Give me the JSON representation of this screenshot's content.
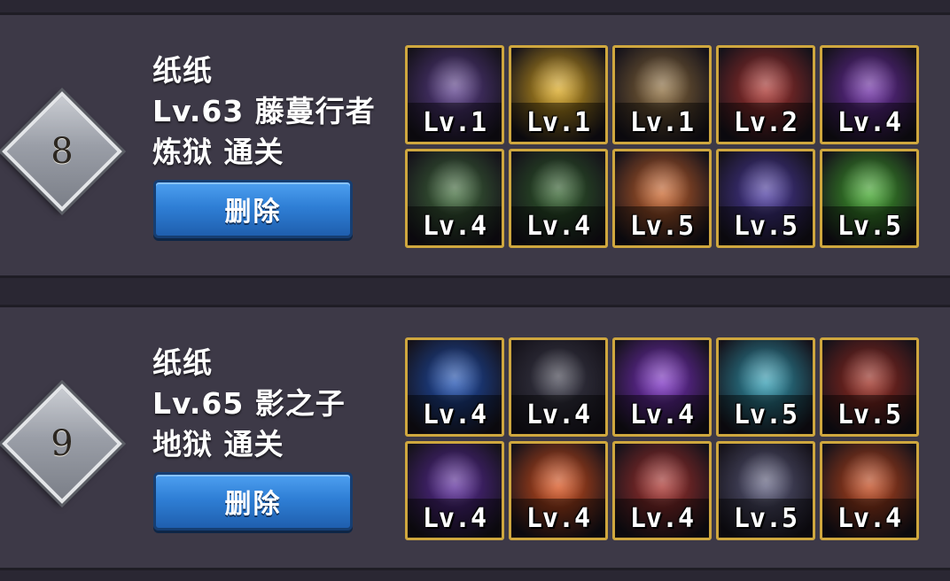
{
  "entries": [
    {
      "rank": "8",
      "name": "纸纸",
      "level_class": "Lv.63 藤蔓行者",
      "stage": "炼狱 通关",
      "delete_label": "删除",
      "skills": [
        {
          "icon": "dark-cloak-icon",
          "level": "Lv.1",
          "color": "#5a3d8a"
        },
        {
          "icon": "golden-burst-icon",
          "level": "Lv.1",
          "color": "#d8a51c"
        },
        {
          "icon": "star-slash-icon",
          "level": "Lv.1",
          "color": "#8a6a3a"
        },
        {
          "icon": "red-claw-icon",
          "level": "Lv.2",
          "color": "#a8312c"
        },
        {
          "icon": "purple-shadow-icon",
          "level": "Lv.4",
          "color": "#6b2ba3"
        },
        {
          "icon": "green-vines-icon",
          "level": "Lv.4",
          "color": "#3f6a3a"
        },
        {
          "icon": "green-blade-icon",
          "level": "Lv.4",
          "color": "#2f5e2a"
        },
        {
          "icon": "shield-emblem-icon",
          "level": "Lv.5",
          "color": "#c8632a"
        },
        {
          "icon": "purple-serpent-icon",
          "level": "Lv.5",
          "color": "#4b3aa0"
        },
        {
          "icon": "green-totem-icon",
          "level": "Lv.5",
          "color": "#3fa52a"
        }
      ]
    },
    {
      "rank": "9",
      "name": "纸纸",
      "level_class": "Lv.65 影之子",
      "stage": "地狱 通关",
      "delete_label": "删除",
      "skills": [
        {
          "icon": "blue-crystal-icon",
          "level": "Lv.4",
          "color": "#1d4fb0"
        },
        {
          "icon": "shadow-rogue-icon",
          "level": "Lv.4",
          "color": "#3a3a48"
        },
        {
          "icon": "purple-vortex-icon",
          "level": "Lv.4",
          "color": "#7a2fc2"
        },
        {
          "icon": "ice-spikes-icon",
          "level": "Lv.5",
          "color": "#2f9ab0"
        },
        {
          "icon": "red-chains-icon",
          "level": "Lv.5",
          "color": "#9a2a1e"
        },
        {
          "icon": "purple-wing-icon",
          "level": "Lv.4",
          "color": "#5a2a9a"
        },
        {
          "icon": "fire-flame-icon",
          "level": "Lv.4",
          "color": "#d8501a"
        },
        {
          "icon": "red-claw-icon",
          "level": "Lv.4",
          "color": "#a8312c"
        },
        {
          "icon": "dark-orb-icon",
          "level": "Lv.5",
          "color": "#5a5a7a"
        },
        {
          "icon": "fire-arrows-icon",
          "level": "Lv.4",
          "color": "#c0461a"
        }
      ]
    }
  ]
}
